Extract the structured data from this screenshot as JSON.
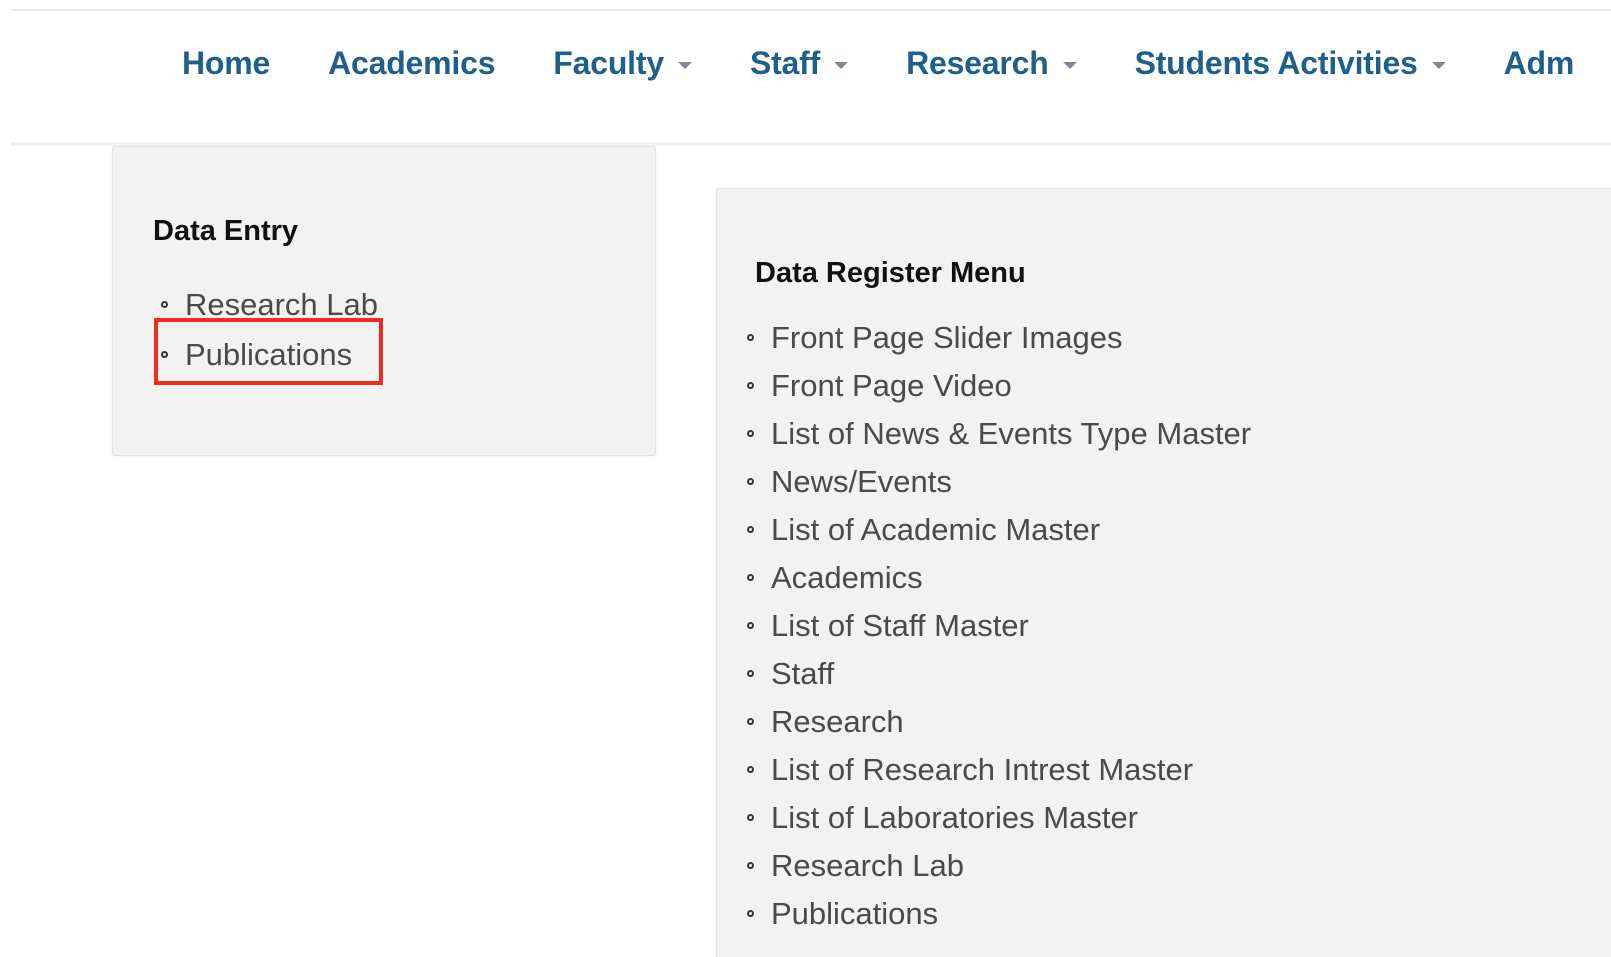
{
  "nav": {
    "items": [
      {
        "label": "Home",
        "dropdown": false
      },
      {
        "label": "Academics",
        "dropdown": false
      },
      {
        "label": "Faculty",
        "dropdown": true
      },
      {
        "label": "Staff",
        "dropdown": true
      },
      {
        "label": "Research",
        "dropdown": true
      },
      {
        "label": "Students Activities",
        "dropdown": true
      },
      {
        "label": "Adm",
        "dropdown": false
      }
    ]
  },
  "data_entry": {
    "title": "Data Entry",
    "items": [
      "Research Lab",
      "Publications"
    ]
  },
  "data_register": {
    "title": "Data Register Menu",
    "items": [
      "Front Page Slider Images",
      "Front Page Video",
      "List of News & Events Type Master",
      "News/Events",
      "List of Academic Master",
      "Academics",
      "List of Staff Master",
      "Staff",
      "Research",
      "List of Research Intrest Master",
      "List of Laboratories Master",
      "Research Lab",
      "Publications"
    ]
  },
  "colors": {
    "nav_text": "#1f5f8b",
    "highlight": "#f12b1d",
    "card_bg": "#f2f2f2"
  }
}
